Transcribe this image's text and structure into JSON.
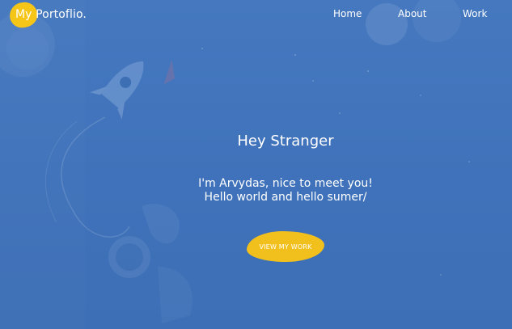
{
  "brand": {
    "logo_text": "My Portoflio.",
    "accent_color": "#f5c518",
    "background_color": "#4176bd"
  },
  "nav": {
    "items": [
      {
        "label": "Home"
      },
      {
        "label": "About"
      },
      {
        "label": "Work"
      }
    ]
  },
  "hero": {
    "title": "Hey Stranger",
    "subtitle_line1": "I'm Arvydas, nice to meet you!",
    "subtitle_line2": "Hello world and hello sumer/",
    "cta_label": "VIEW MY WORK"
  },
  "background": {
    "illustration_icons": [
      "rocket-icon",
      "astronaut-icon",
      "planet-icon"
    ]
  }
}
